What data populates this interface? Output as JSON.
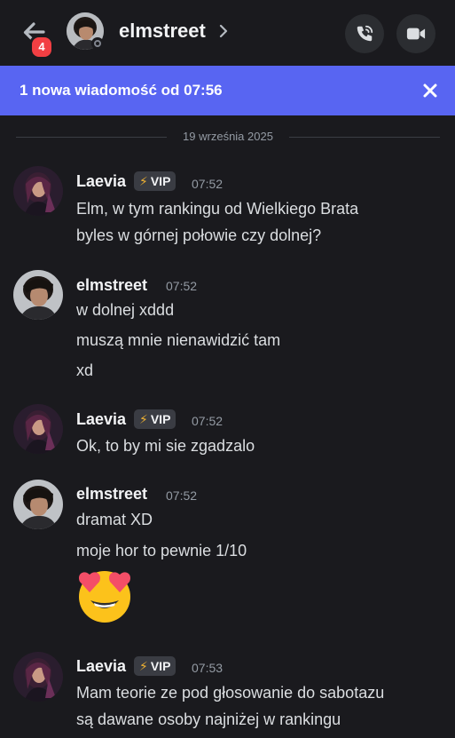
{
  "header": {
    "unread_count": "4",
    "channel_name": "elmstreet"
  },
  "new_message_bar": {
    "text": "1 nowa wiadomość od 07:56"
  },
  "date_divider": "19 września 2025",
  "messages": [
    {
      "author": "Laevia",
      "badge": "VIP",
      "time": "07:52",
      "lines": [
        "Elm, w tym rankingu od Wielkiego Brata",
        "byles w górnej połowie czy dolnej?"
      ]
    },
    {
      "author": "elmstreet",
      "time": "07:52",
      "lines": [
        "w dolnej xddd",
        "muszą mnie nienawidzić tam",
        "xd"
      ]
    },
    {
      "author": "Laevia",
      "badge": "VIP",
      "time": "07:52",
      "lines": [
        "Ok, to by mi sie zgadzalo"
      ]
    },
    {
      "author": "elmstreet",
      "time": "07:52",
      "lines": [
        "dramat XD",
        "moje hor to pewnie 1/10"
      ],
      "emoji": "heart-eyes-emoji"
    },
    {
      "author": "Laevia",
      "badge": "VIP",
      "time": "07:53",
      "lines": [
        "Mam teorie ze pod głosowanie do sabotazu",
        "są dawane osoby najniżej w rankingu"
      ]
    }
  ],
  "colors": {
    "background": "#1a1a1e",
    "accent": "#5865f2",
    "badge_red": "#f23f43",
    "bolt": "#f0b232"
  }
}
